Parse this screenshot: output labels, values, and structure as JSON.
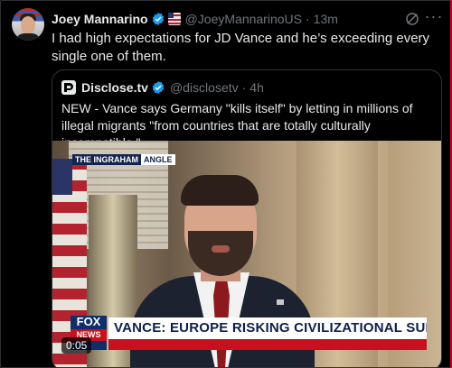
{
  "tweet": {
    "author_name": "Joey Mannarino",
    "handle": "@JoeyMannarinoUS",
    "separator": "·",
    "time": "13m",
    "text": "I had high expectations for JD Vance and he’s exceeding every single one of them.",
    "more_label": "···"
  },
  "quoted": {
    "author_name": "Disclose.tv",
    "handle": "@disclosetv",
    "separator": "·",
    "time": "4h",
    "text": "NEW - Vance says Germany \"kills itself\" by letting in millions of illegal migrants \"from countries that are totally culturally incompatible.\""
  },
  "video": {
    "show_tag_a": "THE INGRAHAM",
    "show_tag_b": "ANGLE",
    "network_logo_top": "FOX",
    "network_logo_bottom": "NEWS",
    "headline": "VANCE: EUROPE RISKING CIVILIZATIONAL SUICIDE",
    "duration": "0:05"
  },
  "colors": {
    "background": "#000000",
    "text_primary": "#e7e9ea",
    "text_secondary": "#71767b",
    "verified_blue": "#1d9bf0",
    "border": "#2f3336",
    "fox_red": "#c8101e",
    "fox_blue": "#0f2f6b"
  },
  "icons": {
    "verified": "verified-badge-icon",
    "gov_badge": "affiliate-flag-icon",
    "grok": "grok-icon",
    "more": "more-options-icon",
    "quoted_logo": "disclose-logo-icon"
  }
}
